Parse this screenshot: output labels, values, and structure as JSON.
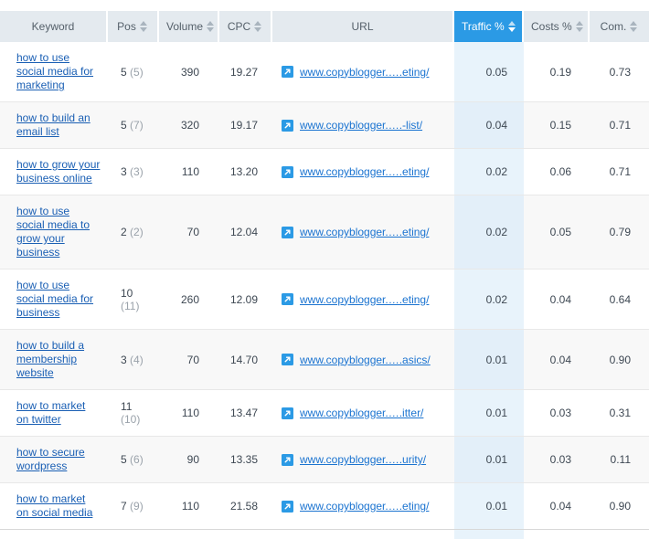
{
  "table": {
    "columns": [
      {
        "key": "keyword",
        "label": "Keyword",
        "sortable": false,
        "active": false
      },
      {
        "key": "pos",
        "label": "Pos",
        "sortable": true,
        "active": false
      },
      {
        "key": "volume",
        "label": "Volume",
        "sortable": true,
        "active": false
      },
      {
        "key": "cpc",
        "label": "CPC",
        "sortable": true,
        "active": false
      },
      {
        "key": "url",
        "label": "URL",
        "sortable": false,
        "active": false
      },
      {
        "key": "traffic",
        "label": "Traffic %",
        "sortable": true,
        "active": true
      },
      {
        "key": "costs",
        "label": "Costs %",
        "sortable": true,
        "active": false
      },
      {
        "key": "com",
        "label": "Com.",
        "sortable": true,
        "active": false
      }
    ],
    "sort": {
      "column": "Traffic %",
      "direction": "desc"
    },
    "accent_color": "#2b9ae5",
    "header_bg": "#e4eaef",
    "highlight_bg": "#e8f3fb",
    "link_color": "#1a5fb4",
    "url_link_color": "#1a73d0",
    "link_icon": "external-link-icon",
    "rows": [
      {
        "keyword": "how to use social media for marketing",
        "pos": "5",
        "pos_prev": "(5)",
        "volume": "390",
        "cpc": "19.27",
        "url": "www.copyblogger.….eting/",
        "traffic": "0.05",
        "costs": "0.19",
        "com": "0.73"
      },
      {
        "keyword": "how to build an email list",
        "pos": "5",
        "pos_prev": "(7)",
        "volume": "320",
        "cpc": "19.17",
        "url": "www.copyblogger.….-list/",
        "traffic": "0.04",
        "costs": "0.15",
        "com": "0.71"
      },
      {
        "keyword": "how to grow your business online",
        "pos": "3",
        "pos_prev": "(3)",
        "volume": "110",
        "cpc": "13.20",
        "url": "www.copyblogger.….eting/",
        "traffic": "0.02",
        "costs": "0.06",
        "com": "0.71"
      },
      {
        "keyword": "how to use social media to grow your business",
        "pos": "2",
        "pos_prev": "(2)",
        "volume": "70",
        "cpc": "12.04",
        "url": "www.copyblogger.….eting/",
        "traffic": "0.02",
        "costs": "0.05",
        "com": "0.79"
      },
      {
        "keyword": "how to use social media for business",
        "pos": "10",
        "pos_prev": "(11)",
        "volume": "260",
        "cpc": "12.09",
        "url": "www.copyblogger.….eting/",
        "traffic": "0.02",
        "costs": "0.04",
        "com": "0.64"
      },
      {
        "keyword": "how to build a membership website",
        "pos": "3",
        "pos_prev": "(4)",
        "volume": "70",
        "cpc": "14.70",
        "url": "www.copyblogger.….asics/",
        "traffic": "0.01",
        "costs": "0.04",
        "com": "0.90"
      },
      {
        "keyword": "how to market on twitter",
        "pos": "11",
        "pos_prev": "(10)",
        "volume": "110",
        "cpc": "13.47",
        "url": "www.copyblogger.….itter/",
        "traffic": "0.01",
        "costs": "0.03",
        "com": "0.31"
      },
      {
        "keyword": "how to secure wordpress",
        "pos": "5",
        "pos_prev": "(6)",
        "volume": "90",
        "cpc": "13.35",
        "url": "www.copyblogger.….urity/",
        "traffic": "0.01",
        "costs": "0.03",
        "com": "0.11"
      },
      {
        "keyword": "how to market on social media",
        "pos": "7",
        "pos_prev": "(9)",
        "volume": "110",
        "cpc": "21.58",
        "url": "www.copyblogger.….eting/",
        "traffic": "0.01",
        "costs": "0.04",
        "com": "0.90"
      }
    ]
  }
}
